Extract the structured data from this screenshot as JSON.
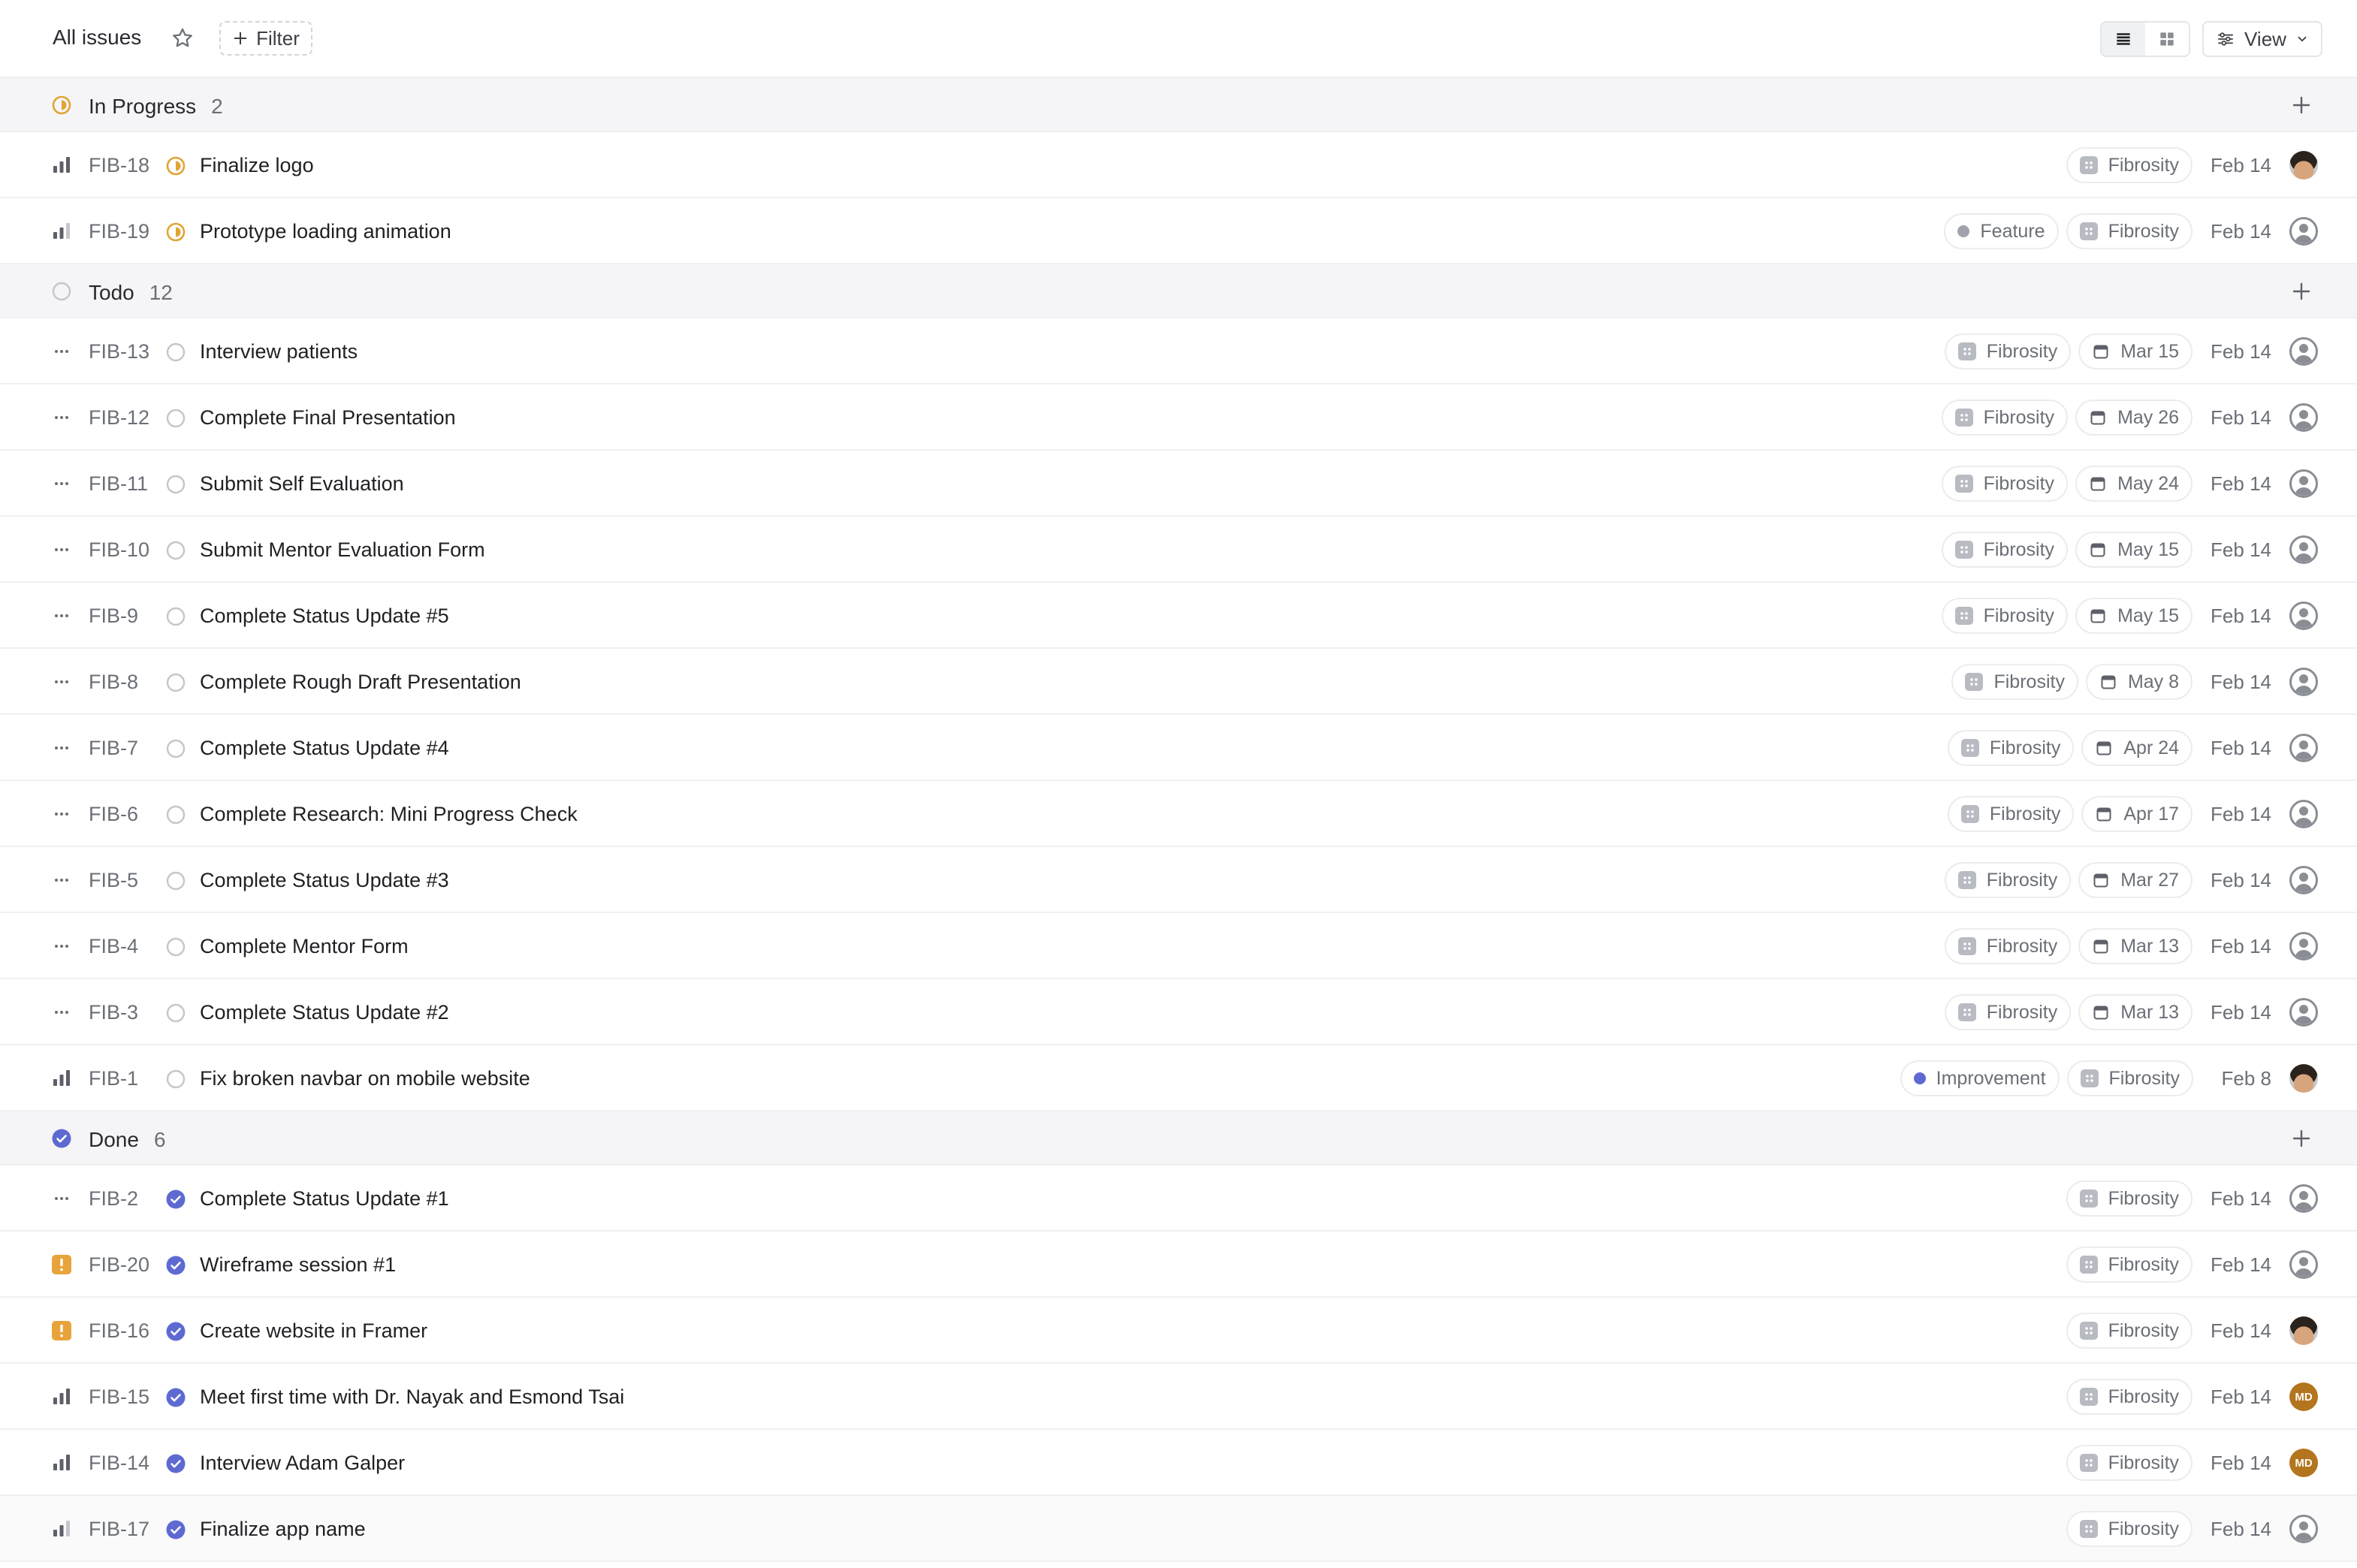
{
  "header": {
    "title": "All issues",
    "filter_label": "Filter",
    "view_label": "View"
  },
  "colors": {
    "in_progress": "#e2a335",
    "done": "#5e6ad2",
    "urgent": "#e8a33b",
    "feature_dot": "#a0a3ab",
    "improvement_dot": "#5e6ad2"
  },
  "groups": [
    {
      "name": "In Progress",
      "count": "2",
      "status": "in_progress",
      "issues": [
        {
          "priority": "high",
          "id": "FIB-18",
          "status": "in_progress",
          "title": "Finalize logo",
          "labels": [],
          "project": "Fibrosity",
          "due": "",
          "date": "Feb 14",
          "avatar": "photo"
        },
        {
          "priority": "medium",
          "id": "FIB-19",
          "status": "in_progress",
          "title": "Prototype loading animation",
          "labels": [
            {
              "name": "Feature",
              "color": "#a0a3ab"
            }
          ],
          "project": "Fibrosity",
          "due": "",
          "date": "Feb 14",
          "avatar": "empty"
        }
      ]
    },
    {
      "name": "Todo",
      "count": "12",
      "status": "todo",
      "issues": [
        {
          "priority": "none",
          "id": "FIB-13",
          "status": "todo",
          "title": "Interview patients",
          "labels": [],
          "project": "Fibrosity",
          "due": "Mar 15",
          "date": "Feb 14",
          "avatar": "empty"
        },
        {
          "priority": "none",
          "id": "FIB-12",
          "status": "todo",
          "title": "Complete Final Presentation",
          "labels": [],
          "project": "Fibrosity",
          "due": "May 26",
          "date": "Feb 14",
          "avatar": "empty"
        },
        {
          "priority": "none",
          "id": "FIB-11",
          "status": "todo",
          "title": "Submit Self Evaluation",
          "labels": [],
          "project": "Fibrosity",
          "due": "May 24",
          "date": "Feb 14",
          "avatar": "empty"
        },
        {
          "priority": "none",
          "id": "FIB-10",
          "status": "todo",
          "title": "Submit Mentor Evaluation Form",
          "labels": [],
          "project": "Fibrosity",
          "due": "May 15",
          "date": "Feb 14",
          "avatar": "empty"
        },
        {
          "priority": "none",
          "id": "FIB-9",
          "status": "todo",
          "title": "Complete Status Update #5",
          "labels": [],
          "project": "Fibrosity",
          "due": "May 15",
          "date": "Feb 14",
          "avatar": "empty"
        },
        {
          "priority": "none",
          "id": "FIB-8",
          "status": "todo",
          "title": "Complete Rough Draft Presentation",
          "labels": [],
          "project": "Fibrosity",
          "due": "May 8",
          "date": "Feb 14",
          "avatar": "empty"
        },
        {
          "priority": "none",
          "id": "FIB-7",
          "status": "todo",
          "title": "Complete Status Update #4",
          "labels": [],
          "project": "Fibrosity",
          "due": "Apr 24",
          "date": "Feb 14",
          "avatar": "empty"
        },
        {
          "priority": "none",
          "id": "FIB-6",
          "status": "todo",
          "title": "Complete Research: Mini Progress Check",
          "labels": [],
          "project": "Fibrosity",
          "due": "Apr 17",
          "date": "Feb 14",
          "avatar": "empty"
        },
        {
          "priority": "none",
          "id": "FIB-5",
          "status": "todo",
          "title": "Complete Status Update #3",
          "labels": [],
          "project": "Fibrosity",
          "due": "Mar 27",
          "date": "Feb 14",
          "avatar": "empty"
        },
        {
          "priority": "none",
          "id": "FIB-4",
          "status": "todo",
          "title": "Complete Mentor Form",
          "labels": [],
          "project": "Fibrosity",
          "due": "Mar 13",
          "date": "Feb 14",
          "avatar": "empty"
        },
        {
          "priority": "none",
          "id": "FIB-3",
          "status": "todo",
          "title": "Complete Status Update #2",
          "labels": [],
          "project": "Fibrosity",
          "due": "Mar 13",
          "date": "Feb 14",
          "avatar": "empty"
        },
        {
          "priority": "high",
          "id": "FIB-1",
          "status": "todo",
          "title": "Fix broken navbar on mobile website",
          "labels": [
            {
              "name": "Improvement",
              "color": "#5e6ad2"
            }
          ],
          "project": "Fibrosity",
          "due": "",
          "date": "Feb 8",
          "avatar": "photo"
        }
      ]
    },
    {
      "name": "Done",
      "count": "6",
      "status": "done",
      "issues": [
        {
          "priority": "none",
          "id": "FIB-2",
          "status": "done",
          "title": "Complete Status Update #1",
          "labels": [],
          "project": "Fibrosity",
          "due": "",
          "date": "Feb 14",
          "avatar": "empty"
        },
        {
          "priority": "urgent",
          "id": "FIB-20",
          "status": "done",
          "title": "Wireframe session #1",
          "labels": [],
          "project": "Fibrosity",
          "due": "",
          "date": "Feb 14",
          "avatar": "empty"
        },
        {
          "priority": "urgent",
          "id": "FIB-16",
          "status": "done",
          "title": "Create website in Framer",
          "labels": [],
          "project": "Fibrosity",
          "due": "",
          "date": "Feb 14",
          "avatar": "photo"
        },
        {
          "priority": "high",
          "id": "FIB-15",
          "status": "done",
          "title": "Meet first time with Dr. Nayak and Esmond Tsai",
          "labels": [],
          "project": "Fibrosity",
          "due": "",
          "date": "Feb 14",
          "avatar": "initials",
          "initials": "MD"
        },
        {
          "priority": "high",
          "id": "FIB-14",
          "status": "done",
          "title": "Interview Adam Galper",
          "labels": [],
          "project": "Fibrosity",
          "due": "",
          "date": "Feb 14",
          "avatar": "initials",
          "initials": "MD"
        },
        {
          "priority": "medium",
          "id": "FIB-17",
          "status": "done",
          "title": "Finalize app name",
          "labels": [],
          "project": "Fibrosity",
          "due": "",
          "date": "Feb 14",
          "avatar": "empty"
        }
      ]
    }
  ]
}
